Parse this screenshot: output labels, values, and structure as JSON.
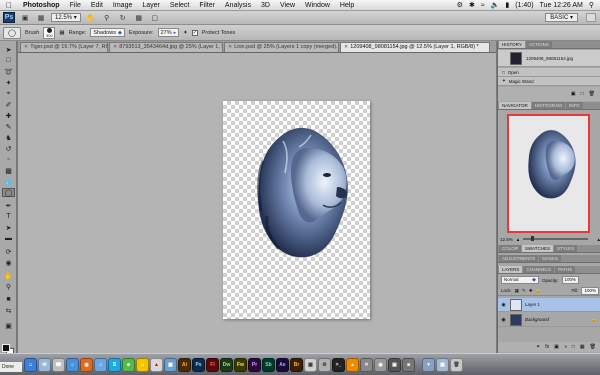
{
  "menubar": {
    "app": "Photoshop",
    "items": [
      "File",
      "Edit",
      "Image",
      "Layer",
      "Select",
      "Filter",
      "Analysis",
      "3D",
      "View",
      "Window",
      "Help"
    ],
    "battery": "(1:40)",
    "clock": "Tue 12:26 AM"
  },
  "appbar": {
    "logo": "Ps",
    "zoom": "12.5",
    "workspace": "BASIC"
  },
  "options": {
    "brush_label": "Brush",
    "brush_size": "300",
    "range_label": "Range:",
    "range_value": "Shadows",
    "exposure_label": "Exposure:",
    "exposure_value": "27%",
    "protect_label": "Protect Tones"
  },
  "tabs": [
    {
      "label": "Tiger.psd @ 16.7% (Layer 7, RG...",
      "active": false
    },
    {
      "label": "8793513_3543464d.jpg @ 25% (Layer 1, RG...",
      "active": false
    },
    {
      "label": "Lion.psd @ 25% (Layers 1 copy (merged)...",
      "active": false
    },
    {
      "label": "1209408_98081154.jpg @ 12.5% (Layer 1, RGB/8) *",
      "active": true
    }
  ],
  "document": {
    "title": "1209408_98081154.jpg @ 12.5% (Layer 1, RGB/8) *"
  },
  "history": {
    "tabs": [
      "HISTORY",
      "ACTIONS"
    ],
    "snapshot": "1209408_98081154.jpg",
    "states": [
      "Open",
      "Magic Wand"
    ]
  },
  "navigator": {
    "tabs": [
      "NAVIGATOR",
      "HISTOGRAM",
      "INFO"
    ],
    "zoom": "12.5%"
  },
  "color": {
    "tabs": [
      "COLOR",
      "SWATCHES",
      "STYLES"
    ]
  },
  "adjustments": {
    "tabs": [
      "ADJUSTMENTS",
      "MASKS"
    ]
  },
  "layers": {
    "tabs": [
      "LAYERS",
      "CHANNELS",
      "PATHS"
    ],
    "blend_mode": "Normal",
    "opacity_label": "Opacity:",
    "opacity": "100%",
    "lock_label": "Lock:",
    "fill_label": "Fill:",
    "fill": "100%",
    "items": [
      "Layer 1",
      "Background"
    ]
  },
  "dock": {
    "finder_label": "Done",
    "icons": [
      "Finder",
      "Mail",
      "iChat",
      "Safari",
      "Firefox",
      "iTunes",
      "Skype",
      "Messenger",
      "Sun",
      "PDF",
      "iPhoto",
      "Illustrator",
      "Photoshop",
      "Flash",
      "Dreamweaver",
      "Fireworks",
      "Premiere",
      "Soundbooth",
      "After Effects",
      "Bridge",
      "Preview",
      "Utility",
      "Terminal",
      "VLC",
      "Tools",
      "Disk",
      "Camera",
      "Trash",
      "Folder",
      "Docs",
      "Trash"
    ]
  },
  "colors": {
    "active_layer": "#a9c3e8",
    "navigator_frame": "#e43a3a"
  }
}
